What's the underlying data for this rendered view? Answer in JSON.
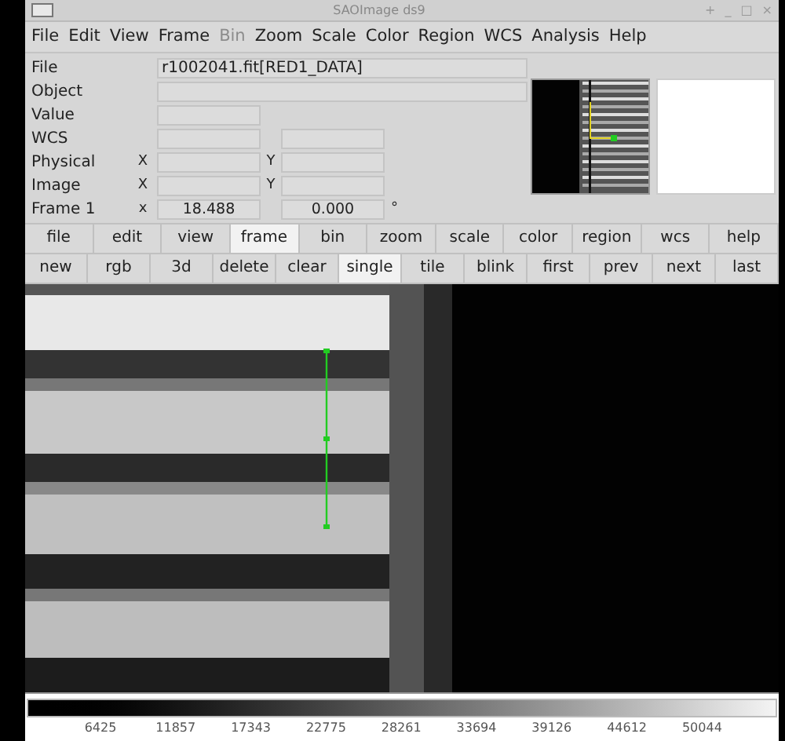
{
  "window": {
    "title": "SAOImage ds9",
    "controls": [
      "+",
      "_",
      "□",
      "×"
    ]
  },
  "menu": [
    {
      "label": "File",
      "disabled": false
    },
    {
      "label": "Edit",
      "disabled": false
    },
    {
      "label": "View",
      "disabled": false
    },
    {
      "label": "Frame",
      "disabled": false
    },
    {
      "label": "Bin",
      "disabled": true
    },
    {
      "label": "Zoom",
      "disabled": false
    },
    {
      "label": "Scale",
      "disabled": false
    },
    {
      "label": "Color",
      "disabled": false
    },
    {
      "label": "Region",
      "disabled": false
    },
    {
      "label": "WCS",
      "disabled": false
    },
    {
      "label": "Analysis",
      "disabled": false
    },
    {
      "label": "Help",
      "disabled": false
    }
  ],
  "info": [
    {
      "kind": "wide",
      "label": "File",
      "value": "r1002041.fit[RED1_DATA]"
    },
    {
      "kind": "wide",
      "label": "Object"
    },
    {
      "kind": "single",
      "label": "Value"
    },
    {
      "kind": "pair",
      "label": "WCS"
    },
    {
      "kind": "xy",
      "label": "Physical",
      "x_label": "X",
      "y_label": "Y"
    },
    {
      "kind": "xy",
      "label": "Image",
      "x_label": "X",
      "y_label": "Y"
    },
    {
      "kind": "xy",
      "label": "Frame 1",
      "x_label": "x",
      "x_value": "18.488",
      "y_value": "0.000",
      "unit": "°"
    }
  ],
  "buttons": [
    {
      "label": "file",
      "selected": false
    },
    {
      "label": "edit",
      "selected": false
    },
    {
      "label": "view",
      "selected": false
    },
    {
      "label": "frame",
      "selected": true
    },
    {
      "label": "bin",
      "selected": false
    },
    {
      "label": "zoom",
      "selected": false
    },
    {
      "label": "scale",
      "selected": false
    },
    {
      "label": "color",
      "selected": false
    },
    {
      "label": "region",
      "selected": false
    },
    {
      "label": "wcs",
      "selected": false
    },
    {
      "label": "help",
      "selected": false
    }
  ],
  "sub_buttons": [
    {
      "label": "new",
      "selected": false
    },
    {
      "label": "rgb",
      "selected": false
    },
    {
      "label": "3d",
      "selected": false
    },
    {
      "label": "delete",
      "selected": false
    },
    {
      "label": "clear",
      "selected": false
    },
    {
      "label": "single",
      "selected": true
    },
    {
      "label": "tile",
      "selected": false
    },
    {
      "label": "blink",
      "selected": false
    },
    {
      "label": "first",
      "selected": false
    },
    {
      "label": "prev",
      "selected": false
    },
    {
      "label": "next",
      "selected": false
    },
    {
      "label": "last",
      "selected": false
    }
  ],
  "colorbar": {
    "ticks": [
      "6425",
      "11857",
      "17343",
      "22775",
      "28261",
      "33694",
      "39126",
      "44612",
      "50044"
    ]
  }
}
